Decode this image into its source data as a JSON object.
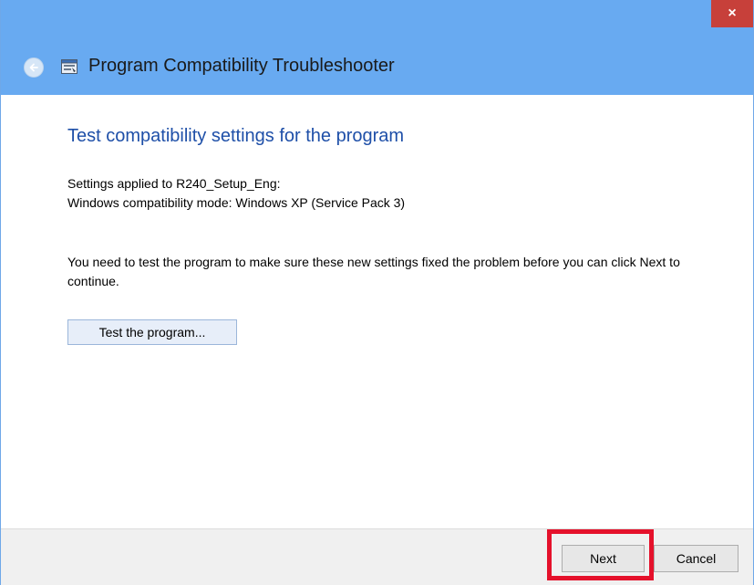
{
  "window": {
    "title": "Program Compatibility Troubleshooter",
    "close_label": "×",
    "back_icon": "back-arrow-icon",
    "app_icon": "troubleshooter-icon",
    "titlebar_color": "#68aaf1",
    "close_color": "#c7403a"
  },
  "main": {
    "heading": "Test compatibility settings for the program",
    "settings_line": "Settings applied to R240_Setup_Eng:",
    "mode_line": "Windows compatibility mode: Windows XP (Service Pack 3)",
    "instruction": "You need to test the program to make sure these new settings fixed the problem before you can click Next to continue.",
    "test_button": "Test the program..."
  },
  "footer": {
    "next_label": "Next",
    "cancel_label": "Cancel"
  },
  "annotation": {
    "highlight_color": "#e5112b"
  }
}
